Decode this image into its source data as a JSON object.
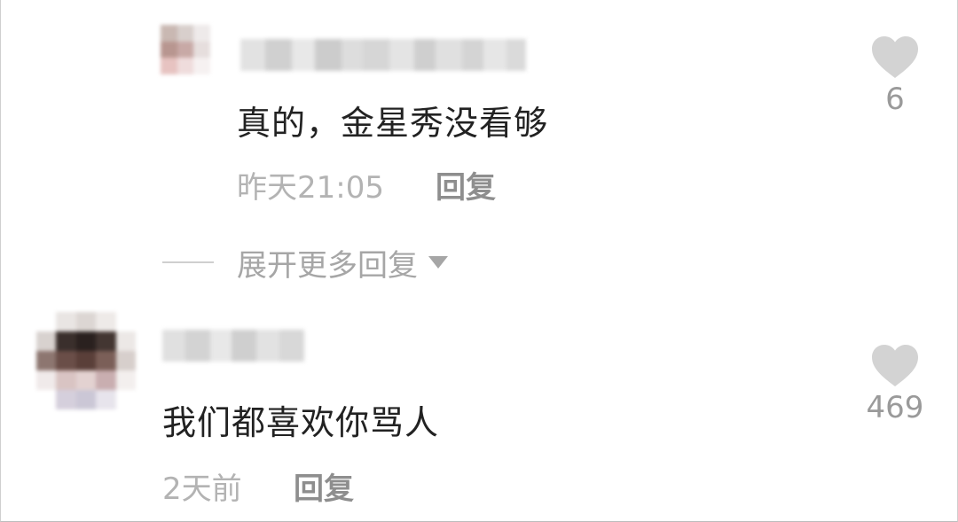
{
  "icons": {
    "heart": "heart-icon",
    "expand": "caret-down-icon"
  },
  "colors": {
    "text_primary": "#222222",
    "text_meta": "#b3b3b3",
    "reply": "#8e8e8e",
    "heart": "#d3d3d3"
  },
  "reply_comment": {
    "text": "真的，金星秀没看够",
    "time": "昨天21:05",
    "reply_label": "回复",
    "likes": "6"
  },
  "expand_replies": {
    "label": "展开更多回复"
  },
  "comment": {
    "text": "我们都喜欢你骂人",
    "time": "2天前",
    "reply_label": "回复",
    "likes": "469"
  }
}
